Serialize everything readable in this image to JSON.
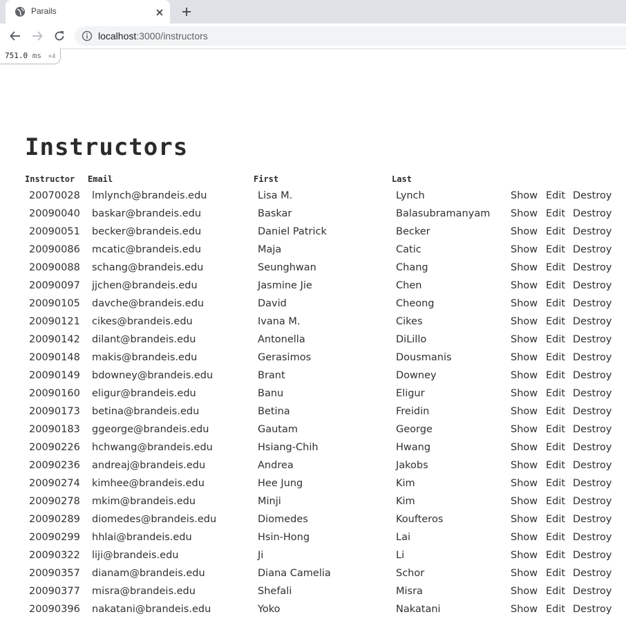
{
  "browser": {
    "tab_title": "Parails",
    "url_host": "localhost",
    "url_path": ":3000/instructors"
  },
  "profiler": {
    "time": "751.0",
    "unit": "ms",
    "count": "×4"
  },
  "page": {
    "title": "Instructors",
    "columns": [
      "Instructor",
      "Email",
      "First",
      "Last"
    ],
    "actions": {
      "show": "Show",
      "edit": "Edit",
      "destroy": "Destroy"
    },
    "rows": [
      {
        "id": "20070028",
        "email": "lmlynch@brandeis.edu",
        "first": "Lisa M.",
        "last": "Lynch"
      },
      {
        "id": "20090040",
        "email": "baskar@brandeis.edu",
        "first": "Baskar",
        "last": "Balasubramanyam"
      },
      {
        "id": "20090051",
        "email": "becker@brandeis.edu",
        "first": "Daniel Patrick",
        "last": "Becker"
      },
      {
        "id": "20090086",
        "email": "mcatic@brandeis.edu",
        "first": "Maja",
        "last": "Catic"
      },
      {
        "id": "20090088",
        "email": "schang@brandeis.edu",
        "first": "Seunghwan",
        "last": "Chang"
      },
      {
        "id": "20090097",
        "email": "jjchen@brandeis.edu",
        "first": "Jasmine Jie",
        "last": "Chen"
      },
      {
        "id": "20090105",
        "email": "davche@brandeis.edu",
        "first": "David",
        "last": "Cheong"
      },
      {
        "id": "20090121",
        "email": "cikes@brandeis.edu",
        "first": "Ivana M.",
        "last": "Cikes"
      },
      {
        "id": "20090142",
        "email": "dilant@brandeis.edu",
        "first": "Antonella",
        "last": "DiLillo"
      },
      {
        "id": "20090148",
        "email": "makis@brandeis.edu",
        "first": "Gerasimos",
        "last": "Dousmanis"
      },
      {
        "id": "20090149",
        "email": "bdowney@brandeis.edu",
        "first": "Brant",
        "last": "Downey"
      },
      {
        "id": "20090160",
        "email": "eligur@brandeis.edu",
        "first": "Banu",
        "last": "Eligur"
      },
      {
        "id": "20090173",
        "email": "betina@brandeis.edu",
        "first": "Betina",
        "last": "Freidin"
      },
      {
        "id": "20090183",
        "email": "ggeorge@brandeis.edu",
        "first": "Gautam",
        "last": "George"
      },
      {
        "id": "20090226",
        "email": "hchwang@brandeis.edu",
        "first": "Hsiang-Chih",
        "last": "Hwang"
      },
      {
        "id": "20090236",
        "email": "andreaj@brandeis.edu",
        "first": "Andrea",
        "last": "Jakobs"
      },
      {
        "id": "20090274",
        "email": "kimhee@brandeis.edu",
        "first": "Hee Jung",
        "last": "Kim"
      },
      {
        "id": "20090278",
        "email": "mkim@brandeis.edu",
        "first": "Minji",
        "last": "Kim"
      },
      {
        "id": "20090289",
        "email": "diomedes@brandeis.edu",
        "first": "Diomedes",
        "last": "Koufteros"
      },
      {
        "id": "20090299",
        "email": "hhlai@brandeis.edu",
        "first": "Hsin-Hong",
        "last": "Lai"
      },
      {
        "id": "20090322",
        "email": "liji@brandeis.edu",
        "first": "Ji",
        "last": "Li"
      },
      {
        "id": "20090357",
        "email": "dianam@brandeis.edu",
        "first": "Diana Camelia",
        "last": "Schor"
      },
      {
        "id": "20090377",
        "email": "misra@brandeis.edu",
        "first": "Shefali",
        "last": "Misra"
      },
      {
        "id": "20090396",
        "email": "nakatani@brandeis.edu",
        "first": "Yoko",
        "last": "Nakatani"
      }
    ]
  }
}
